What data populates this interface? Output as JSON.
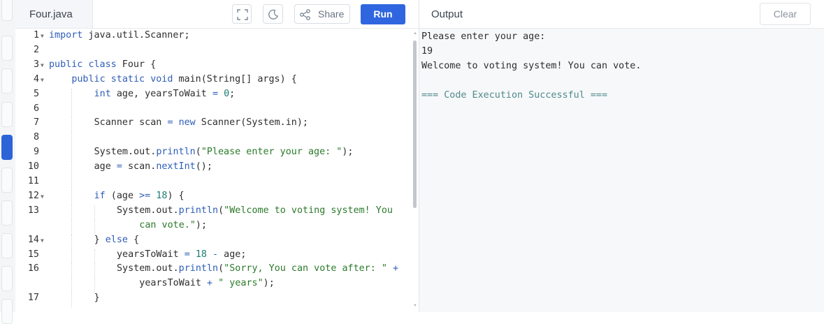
{
  "editor": {
    "file_name": "Four.java",
    "share_label": "Share",
    "run_label": "Run",
    "lines": [
      {
        "n": "1",
        "fold": true,
        "indent": 0,
        "tokens": [
          [
            "kw",
            "import"
          ],
          [
            "t",
            " java.util.Scanner;"
          ]
        ]
      },
      {
        "n": "2",
        "fold": false,
        "indent": 0,
        "tokens": []
      },
      {
        "n": "3",
        "fold": true,
        "indent": 0,
        "tokens": [
          [
            "kw",
            "public"
          ],
          [
            "t",
            " "
          ],
          [
            "kw",
            "class"
          ],
          [
            "t",
            " Four {"
          ]
        ]
      },
      {
        "n": "4",
        "fold": true,
        "indent": 1,
        "tokens": [
          [
            "kw",
            "public"
          ],
          [
            "t",
            " "
          ],
          [
            "kw",
            "static"
          ],
          [
            "t",
            " "
          ],
          [
            "kw",
            "void"
          ],
          [
            "t",
            " main(String[] args) {"
          ]
        ]
      },
      {
        "n": "5",
        "fold": false,
        "indent": 2,
        "tokens": [
          [
            "kw",
            "int"
          ],
          [
            "t",
            " age, yearsToWait "
          ],
          [
            "kw",
            "="
          ],
          [
            "t",
            " "
          ],
          [
            "num",
            "0"
          ],
          [
            "t",
            ";"
          ]
        ]
      },
      {
        "n": "6",
        "fold": false,
        "indent": 2,
        "tokens": []
      },
      {
        "n": "7",
        "fold": false,
        "indent": 2,
        "tokens": [
          [
            "t",
            "Scanner scan "
          ],
          [
            "kw",
            "="
          ],
          [
            "t",
            " "
          ],
          [
            "kw",
            "new"
          ],
          [
            "t",
            " Scanner(System.in);"
          ]
        ]
      },
      {
        "n": "8",
        "fold": false,
        "indent": 2,
        "tokens": []
      },
      {
        "n": "9",
        "fold": false,
        "indent": 2,
        "tokens": [
          [
            "t",
            "System.out."
          ],
          [
            "kw",
            "println"
          ],
          [
            "t",
            "("
          ],
          [
            "str",
            "\"Please enter your age: \""
          ],
          [
            "t",
            ");"
          ]
        ]
      },
      {
        "n": "10",
        "fold": false,
        "indent": 2,
        "tokens": [
          [
            "t",
            "age "
          ],
          [
            "kw",
            "="
          ],
          [
            "t",
            " scan."
          ],
          [
            "kw",
            "nextInt"
          ],
          [
            "t",
            "();"
          ]
        ]
      },
      {
        "n": "11",
        "fold": false,
        "indent": 2,
        "tokens": []
      },
      {
        "n": "12",
        "fold": true,
        "indent": 2,
        "tokens": [
          [
            "kw",
            "if"
          ],
          [
            "t",
            " (age "
          ],
          [
            "kw",
            ">="
          ],
          [
            "t",
            " "
          ],
          [
            "num",
            "18"
          ],
          [
            "t",
            ") {"
          ]
        ]
      },
      {
        "n": "13",
        "fold": false,
        "indent": 3,
        "tokens": [
          [
            "t",
            "System.out."
          ],
          [
            "kw",
            "println"
          ],
          [
            "t",
            "("
          ],
          [
            "str",
            "\"Welcome to voting system! You"
          ]
        ]
      },
      {
        "n": "",
        "fold": false,
        "indent": 4,
        "tokens": [
          [
            "str",
            "can vote.\""
          ],
          [
            "t",
            ");"
          ]
        ]
      },
      {
        "n": "14",
        "fold": true,
        "indent": 2,
        "tokens": [
          [
            "t",
            "} "
          ],
          [
            "kw",
            "else"
          ],
          [
            "t",
            " {"
          ]
        ]
      },
      {
        "n": "15",
        "fold": false,
        "indent": 3,
        "tokens": [
          [
            "t",
            "yearsToWait "
          ],
          [
            "kw",
            "="
          ],
          [
            "t",
            " "
          ],
          [
            "num",
            "18"
          ],
          [
            "t",
            " "
          ],
          [
            "kw",
            "-"
          ],
          [
            "t",
            " age;"
          ]
        ]
      },
      {
        "n": "16",
        "fold": false,
        "indent": 3,
        "tokens": [
          [
            "t",
            "System.out."
          ],
          [
            "kw",
            "println"
          ],
          [
            "t",
            "("
          ],
          [
            "str",
            "\"Sorry, You can vote after: \""
          ],
          [
            "t",
            " "
          ],
          [
            "kw",
            "+"
          ]
        ]
      },
      {
        "n": "",
        "fold": false,
        "indent": 4,
        "tokens": [
          [
            "t",
            "yearsToWait "
          ],
          [
            "kw",
            "+"
          ],
          [
            "t",
            " "
          ],
          [
            "str",
            "\" years\""
          ],
          [
            "t",
            ");"
          ]
        ]
      },
      {
        "n": "17",
        "fold": false,
        "indent": 2,
        "tokens": [
          [
            "t",
            "}"
          ]
        ]
      }
    ]
  },
  "output": {
    "title": "Output",
    "clear_label": "Clear",
    "lines": [
      "Please enter your age:",
      "19",
      "Welcome to voting system! You can vote.",
      "",
      "=== Code Execution Successful ==="
    ]
  },
  "icons": {
    "fullscreen": "fullscreen-icon",
    "theme": "moon-icon",
    "share": "share-icon",
    "fold": "fold-arrow-icon"
  },
  "colors": {
    "run_button": "#2f66e0",
    "keyword": "#2f5eb8",
    "string": "#2b7a2b",
    "number": "#1d7c72",
    "success": "#4f8a8b"
  }
}
